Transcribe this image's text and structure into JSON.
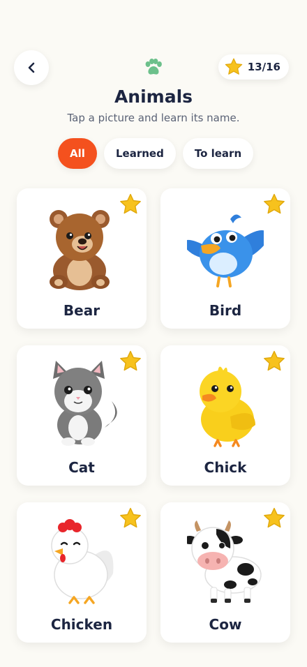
{
  "header": {
    "back_icon": "chevron-left-icon",
    "category_icon": "paw-icon",
    "stars_count": "13/16",
    "title": "Animals",
    "subtitle": "Tap a picture and learn its name."
  },
  "filters": [
    {
      "label": "All",
      "active": true
    },
    {
      "label": "Learned",
      "active": false
    },
    {
      "label": "To learn",
      "active": false
    }
  ],
  "cards": [
    {
      "name": "Bear",
      "learned": true
    },
    {
      "name": "Bird",
      "learned": true
    },
    {
      "name": "Cat",
      "learned": true
    },
    {
      "name": "Chick",
      "learned": true
    },
    {
      "name": "Chicken",
      "learned": true
    },
    {
      "name": "Cow",
      "learned": true
    }
  ],
  "colors": {
    "accent": "#f4511e",
    "star": "#f7c21d",
    "paw": "#6cc08b",
    "text": "#1c2541"
  }
}
